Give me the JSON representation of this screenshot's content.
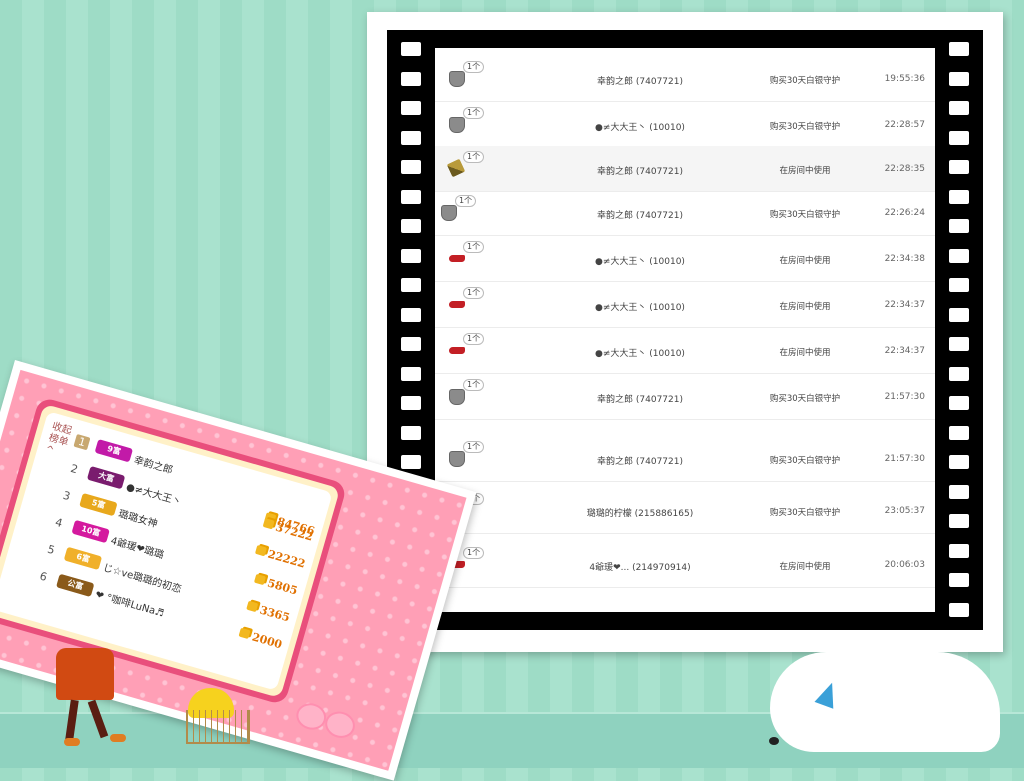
{
  "records": [
    {
      "icon": "shield-icon",
      "count": "1个",
      "user": "幸韵之郎 (7407721)",
      "action": "购买30天白银守护",
      "time": "19:55:36",
      "shade": false
    },
    {
      "icon": "shield-icon",
      "count": "1个",
      "user": "●≠大大王丶 (10010)",
      "action": "购买30天白银守护",
      "time": "22:28:57",
      "shade": false
    },
    {
      "icon": "sword-icon",
      "count": "1个",
      "user": "幸韵之郎 (7407721)",
      "action": "在房间中使用",
      "time": "22:28:35",
      "shade": true
    },
    {
      "icon": "shield-icon",
      "count": "1个",
      "user": "幸韵之郎 (7407721)",
      "action": "购买30天白银守护",
      "time": "22:26:24",
      "shade": false
    },
    {
      "icon": "shoe-icon",
      "count": "1个",
      "user": "●≠大大王丶 (10010)",
      "action": "在房间中使用",
      "time": "22:34:38",
      "shade": false
    },
    {
      "icon": "shoe-icon",
      "count": "1个",
      "user": "●≠大大王丶 (10010)",
      "action": "在房间中使用",
      "time": "22:34:37",
      "shade": false
    },
    {
      "icon": "shoe-icon",
      "count": "1个",
      "user": "●≠大大王丶 (10010)",
      "action": "在房间中使用",
      "time": "22:34:37",
      "shade": false
    },
    {
      "icon": "shield-icon",
      "count": "1个",
      "user": "幸韵之郎 (7407721)",
      "action": "购买30天白银守护",
      "time": "21:57:30",
      "shade": false
    },
    {
      "icon": "shield-icon",
      "count": "1个",
      "user": "幸韵之郎 (7407721)",
      "action": "购买30天白银守护",
      "time": "21:57:30",
      "shade": false
    },
    {
      "icon": "shield-icon",
      "count": "1个",
      "user": "璐璐的柠檬 (215886165)",
      "action": "购买30天白银守护",
      "time": "23:05:37",
      "shade": false
    },
    {
      "icon": "shoe-icon",
      "count": "1个",
      "user": "4爺瑗❤... (214970914)",
      "action": "在房间中使用",
      "time": "20:06:03",
      "shade": false
    }
  ],
  "ranking": {
    "collapse_label": "收起榜单 ^",
    "rows": [
      {
        "rank": "1",
        "badge": "9富",
        "badge_color": "#c21aa8",
        "name": "幸韵之郎",
        "coins": "84766"
      },
      {
        "rank": "2",
        "badge": "大富",
        "badge_color": "#7a1c6e",
        "name": "●≠大大王丶",
        "coins": "37222"
      },
      {
        "rank": "3",
        "badge": "5富",
        "badge_color": "#e8a81c",
        "name": "璐璐女神",
        "coins": "22222"
      },
      {
        "rank": "4",
        "badge": "10富",
        "badge_color": "#d41a9e",
        "name": "4爺瑗❤璐璐",
        "coins": "5805"
      },
      {
        "rank": "5",
        "badge": "6富",
        "badge_color": "#f0b02a",
        "name": "じ☆ve璐璐的初恋",
        "coins": "3365"
      },
      {
        "rank": "6",
        "badge": "公富",
        "badge_color": "#8a5a1a",
        "name": "❤ °咖啡LuNa♬",
        "coins": "2000"
      }
    ]
  }
}
